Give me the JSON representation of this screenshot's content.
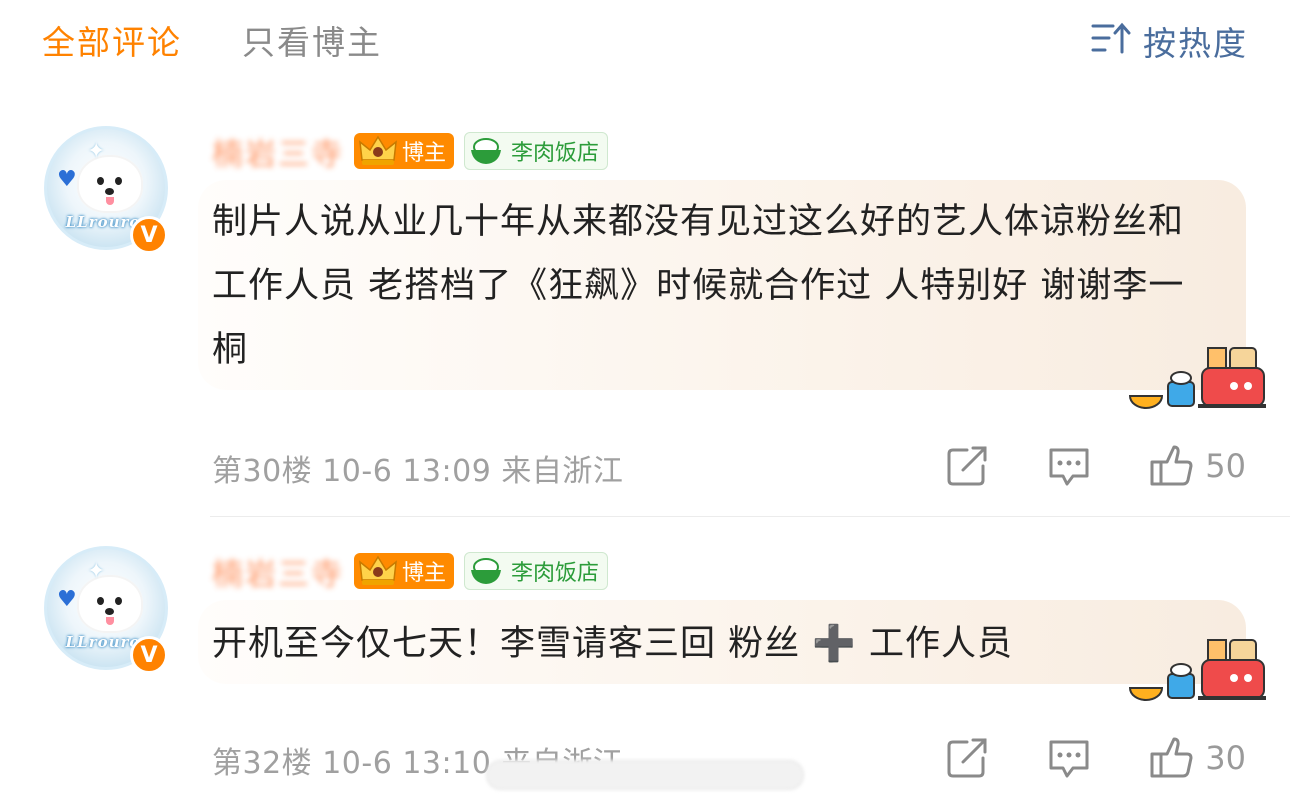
{
  "tabs": {
    "all_comments": "全部评论",
    "author_only": "只看博主",
    "sort_label": "按热度"
  },
  "comments": [
    {
      "username": "楠岩三寺",
      "author_badge": "博主",
      "fan_badge": "李肉饭店",
      "avatar_text": "LLrourou",
      "verified_mark": "V",
      "text": "制片人说从业几十年从来都没有见过这么好的艺人体谅粉丝和工作人员 老搭档了《狂飙》时候就合作过 人特别好 谢谢李一桐",
      "meta": "第30楼 10-6 13:09 来自浙江",
      "likes": "50"
    },
    {
      "username": "楠岩三寺",
      "author_badge": "博主",
      "fan_badge": "李肉饭店",
      "avatar_text": "LLrourou",
      "verified_mark": "V",
      "text": "开机至今仅七天！李雪请客三回 粉丝 ➕ 工作人员",
      "meta": "第32楼 10-6 13:10 来自浙江",
      "likes": "30"
    }
  ],
  "colors": {
    "accent": "#ff8200",
    "sort": "#4a6d9d",
    "fan_badge": "#2c9c3a",
    "meta": "#a0a0a0"
  },
  "icons": [
    "sort-icon",
    "share-icon",
    "comment-icon",
    "like-icon",
    "crown-icon",
    "rice-bowl-icon",
    "verified-icon"
  ]
}
